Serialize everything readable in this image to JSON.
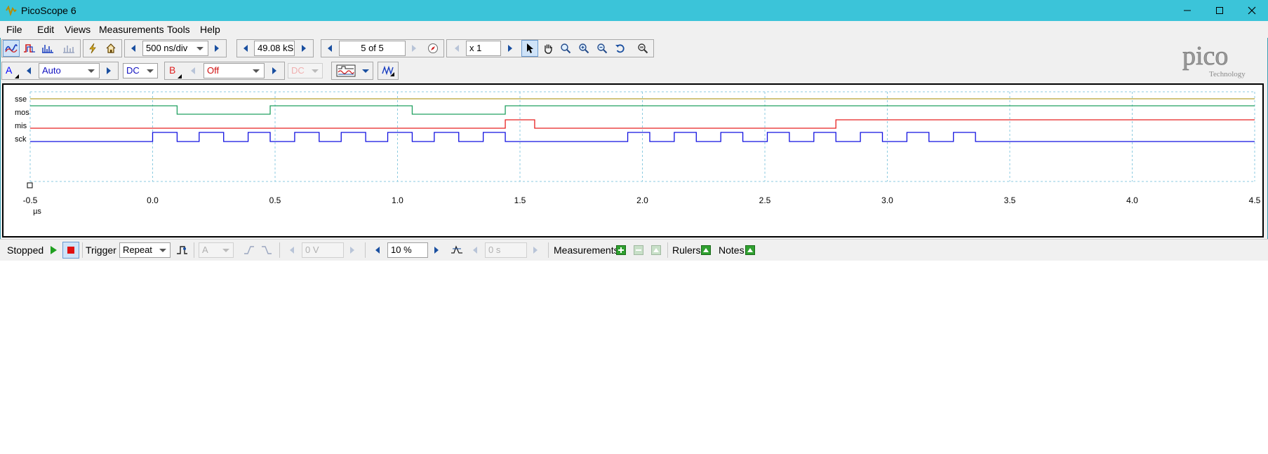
{
  "window": {
    "title": "PicoScope 6"
  },
  "menu": [
    {
      "label": "File",
      "x": 0
    },
    {
      "label": "Edit"
    },
    {
      "label": "Views"
    },
    {
      "label": "Measurements"
    },
    {
      "label": "Tools"
    },
    {
      "label": "Help"
    }
  ],
  "toolbar": {
    "timebase": "500 ns/div",
    "samples": "49.08 kS",
    "capture": "5 of 5",
    "zoom": "x 1"
  },
  "channel_bar": {
    "channel_a": {
      "label": "A",
      "range": "Auto",
      "coupling": "DC",
      "color": "#0000ff"
    },
    "channel_b": {
      "label": "B",
      "range": "Off",
      "coupling": "DC",
      "color": "#e02020"
    }
  },
  "scope": {
    "unit": "µs",
    "x_ticks": [
      "-0.5",
      "0.0",
      "0.5",
      "1.0",
      "1.5",
      "2.0",
      "2.5",
      "3.0",
      "3.5",
      "4.0",
      "4.5"
    ],
    "signals": [
      {
        "name": "sse",
        "color": "#b8a030"
      },
      {
        "name": "mos",
        "color": "#20a060"
      },
      {
        "name": "mis",
        "color": "#e82020"
      },
      {
        "name": "sck",
        "color": "#1010e0"
      }
    ]
  },
  "chart_data": {
    "type": "line",
    "xlabel": "µs",
    "xlim": [
      -0.5,
      4.5
    ],
    "series": [
      {
        "name": "sse",
        "x": [
          -0.5,
          4.5
        ],
        "y": [
          1,
          1
        ]
      },
      {
        "name": "mos",
        "x": [
          -0.5,
          0.1,
          0.1,
          0.48,
          0.48,
          1.06,
          1.06,
          1.44,
          1.44,
          4.5
        ],
        "y": [
          1,
          1,
          0,
          0,
          1,
          1,
          0,
          0,
          1,
          1
        ]
      },
      {
        "name": "mis",
        "x": [
          -0.5,
          1.44,
          1.44,
          1.56,
          1.56,
          2.79,
          2.79,
          4.5
        ],
        "y": [
          0,
          0,
          1,
          1,
          0,
          0,
          1,
          1
        ]
      },
      {
        "name": "sck",
        "edges": [
          0.0,
          0.1,
          0.19,
          0.29,
          0.39,
          0.48,
          0.58,
          0.68,
          0.77,
          0.87,
          0.96,
          1.06,
          1.15,
          1.25,
          1.35,
          1.44,
          1.94,
          2.03,
          2.13,
          2.22,
          2.32,
          2.41,
          2.51,
          2.6,
          2.7,
          2.79,
          2.89,
          2.98,
          3.08,
          3.17,
          3.27,
          3.36
        ],
        "start_level": 0,
        "xlim": [
          -0.5,
          4.5
        ]
      }
    ]
  },
  "statusbar": {
    "state": "Stopped",
    "trigger_label": "Trigger",
    "trigger_mode": "Repeat",
    "trigger_channel": "A",
    "threshold": "0 V",
    "pretrigger": "10 %",
    "delay": "0 s",
    "measurements": "Measurements",
    "rulers": "Rulers",
    "notes": "Notes"
  },
  "logo": {
    "brand": "pico",
    "sub": "Technology"
  }
}
